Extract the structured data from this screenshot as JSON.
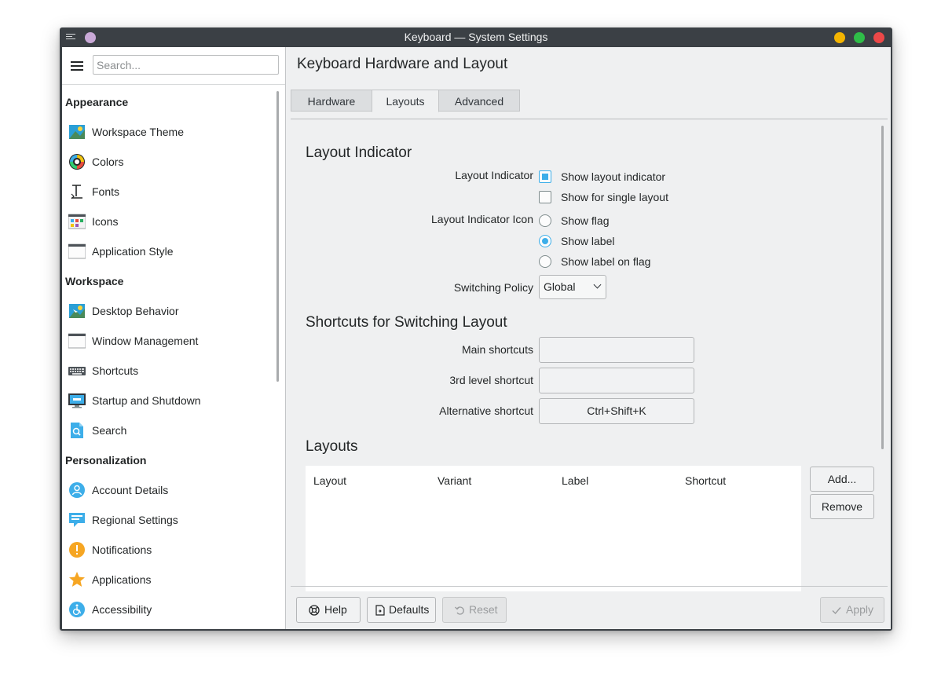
{
  "window": {
    "title": "Keyboard — System Settings"
  },
  "sidebar": {
    "search_placeholder": "Search...",
    "categories": [
      {
        "label": "Appearance",
        "items": [
          {
            "label": "Workspace Theme",
            "icon": "workspace-theme-icon"
          },
          {
            "label": "Colors",
            "icon": "colors-icon"
          },
          {
            "label": "Fonts",
            "icon": "fonts-icon"
          },
          {
            "label": "Icons",
            "icon": "icons-icon"
          },
          {
            "label": "Application Style",
            "icon": "application-style-icon"
          }
        ]
      },
      {
        "label": "Workspace",
        "items": [
          {
            "label": "Desktop Behavior",
            "icon": "desktop-behavior-icon"
          },
          {
            "label": "Window Management",
            "icon": "window-management-icon"
          },
          {
            "label": "Shortcuts",
            "icon": "keyboard-shortcuts-icon"
          },
          {
            "label": "Startup and Shutdown",
            "icon": "startup-shutdown-icon"
          },
          {
            "label": "Search",
            "icon": "search-icon"
          }
        ]
      },
      {
        "label": "Personalization",
        "items": [
          {
            "label": "Account Details",
            "icon": "account-icon"
          },
          {
            "label": "Regional Settings",
            "icon": "regional-settings-icon"
          },
          {
            "label": "Notifications",
            "icon": "notifications-icon"
          },
          {
            "label": "Applications",
            "icon": "applications-star-icon"
          },
          {
            "label": "Accessibility",
            "icon": "accessibility-icon"
          }
        ]
      }
    ]
  },
  "main": {
    "title": "Keyboard Hardware and Layout",
    "tabs": [
      "Hardware",
      "Layouts",
      "Advanced"
    ],
    "active_tab": "Layouts",
    "layout_indicator": {
      "heading": "Layout Indicator",
      "indicator_label": "Layout Indicator",
      "show_indicator": "Show layout indicator",
      "show_indicator_checked": true,
      "show_single": "Show for single layout",
      "show_single_checked": false,
      "icon_label": "Layout Indicator Icon",
      "icon_options": [
        "Show flag",
        "Show label",
        "Show label on flag"
      ],
      "icon_selected": "Show label",
      "policy_label": "Switching Policy",
      "policy_value": "Global"
    },
    "shortcuts": {
      "heading": "Shortcuts for Switching Layout",
      "main_label": "Main shortcuts",
      "main_value": "",
      "third_label": "3rd level shortcut",
      "third_value": "",
      "alt_label": "Alternative shortcut",
      "alt_value": "Ctrl+Shift+K"
    },
    "layouts": {
      "heading": "Layouts",
      "columns": [
        "Layout",
        "Variant",
        "Label",
        "Shortcut"
      ],
      "rows": [],
      "add_label": "Add...",
      "remove_label": "Remove"
    }
  },
  "footer": {
    "help": "Help",
    "defaults": "Defaults",
    "reset": "Reset",
    "apply": "Apply"
  },
  "colors": {
    "accent": "#3daee9",
    "titlebar": "#3b4045",
    "window_bg": "#eff0f1"
  }
}
